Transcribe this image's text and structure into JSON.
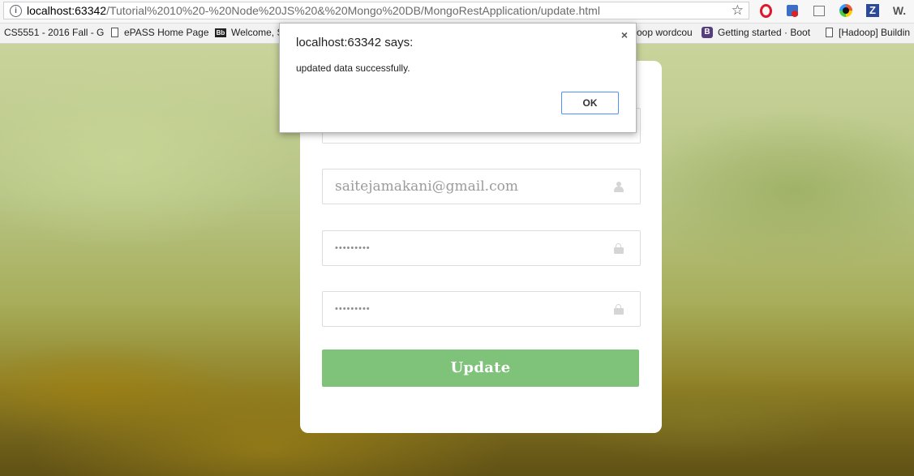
{
  "browser": {
    "url_host": "localhost:63342",
    "url_path": "/Tutorial%2010%20-%20Node%20JS%20&%20Mongo%20DB/MongoRestApplication/update.html",
    "star_icon": "star-icon",
    "extensions": [
      "opera-icon",
      "extension-icon",
      "note-icon",
      "color-ring-icon",
      "z-icon",
      "w-icon"
    ],
    "ext_z_label": "Z",
    "ext_w_label": "W."
  },
  "bookmarks": [
    {
      "label": "CS5551 - 2016 Fall - G",
      "icon": "none"
    },
    {
      "label": "ePASS Home Page",
      "icon": "page-icon"
    },
    {
      "label": "Welcome, S",
      "icon": "blackboard-icon",
      "badge": "Bb"
    },
    {
      "label": "oop wordcou",
      "icon": "none"
    },
    {
      "label": "Getting started · Boot",
      "icon": "bootstrap-icon",
      "badge": "B"
    },
    {
      "label": "[Hadoop] Buildin",
      "icon": "page-icon"
    }
  ],
  "form": {
    "email_value": "saitejamakani@gmail.com",
    "password_value": "•••••••••",
    "confirm_password_value": "•••••••••",
    "update_label": "Update"
  },
  "dialog": {
    "title": "localhost:63342 says:",
    "message": "updated data successfully.",
    "ok_label": "OK",
    "close_glyph": "×"
  }
}
